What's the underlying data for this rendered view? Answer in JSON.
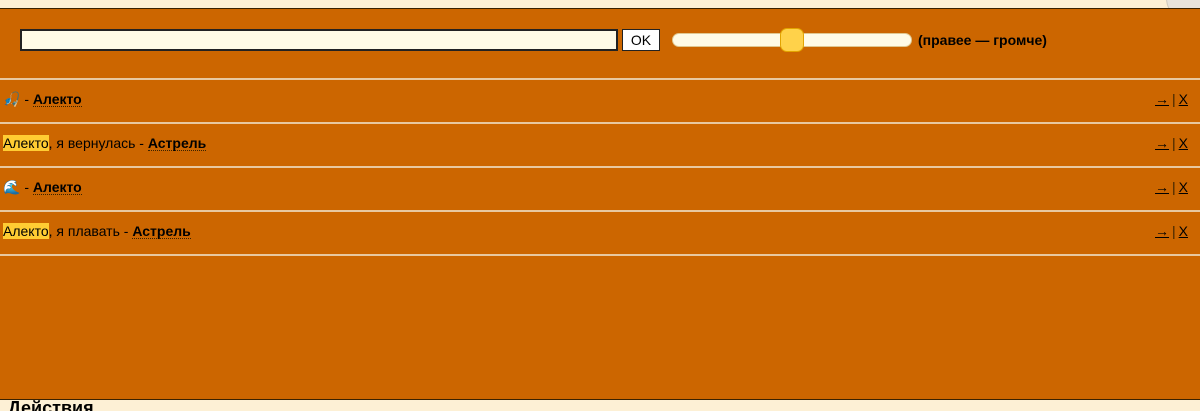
{
  "composer": {
    "input_value": "",
    "ok_label": "OK",
    "volume_hint": "(правее — громче)",
    "volume_level": 0.5
  },
  "messages": [
    {
      "parts": [
        {
          "text": "🎣",
          "kind": "emoji"
        },
        {
          "text": " - ",
          "kind": "plain"
        },
        {
          "text": "Алекто",
          "kind": "nick"
        }
      ],
      "reply_label": "→",
      "separator": "|",
      "delete_label": "X"
    },
    {
      "parts": [
        {
          "text": "Алекто",
          "kind": "highlight"
        },
        {
          "text": ", я вернулась - ",
          "kind": "plain"
        },
        {
          "text": "Астрель",
          "kind": "nick"
        }
      ],
      "reply_label": "→",
      "separator": "|",
      "delete_label": "X"
    },
    {
      "parts": [
        {
          "text": "🌊",
          "kind": "emoji"
        },
        {
          "text": " - ",
          "kind": "plain"
        },
        {
          "text": "Алекто",
          "kind": "nick"
        }
      ],
      "reply_label": "→",
      "separator": "|",
      "delete_label": "X"
    },
    {
      "parts": [
        {
          "text": "Алекто",
          "kind": "highlight"
        },
        {
          "text": ", я плавать - ",
          "kind": "plain"
        },
        {
          "text": "Астрель",
          "kind": "nick"
        }
      ],
      "reply_label": "→",
      "separator": "|",
      "delete_label": "X"
    }
  ],
  "actions_section": {
    "title": "Действия"
  },
  "colors": {
    "panel": "#cc6600",
    "highlight": "#ffcc33",
    "page": "#fdf0d5"
  }
}
